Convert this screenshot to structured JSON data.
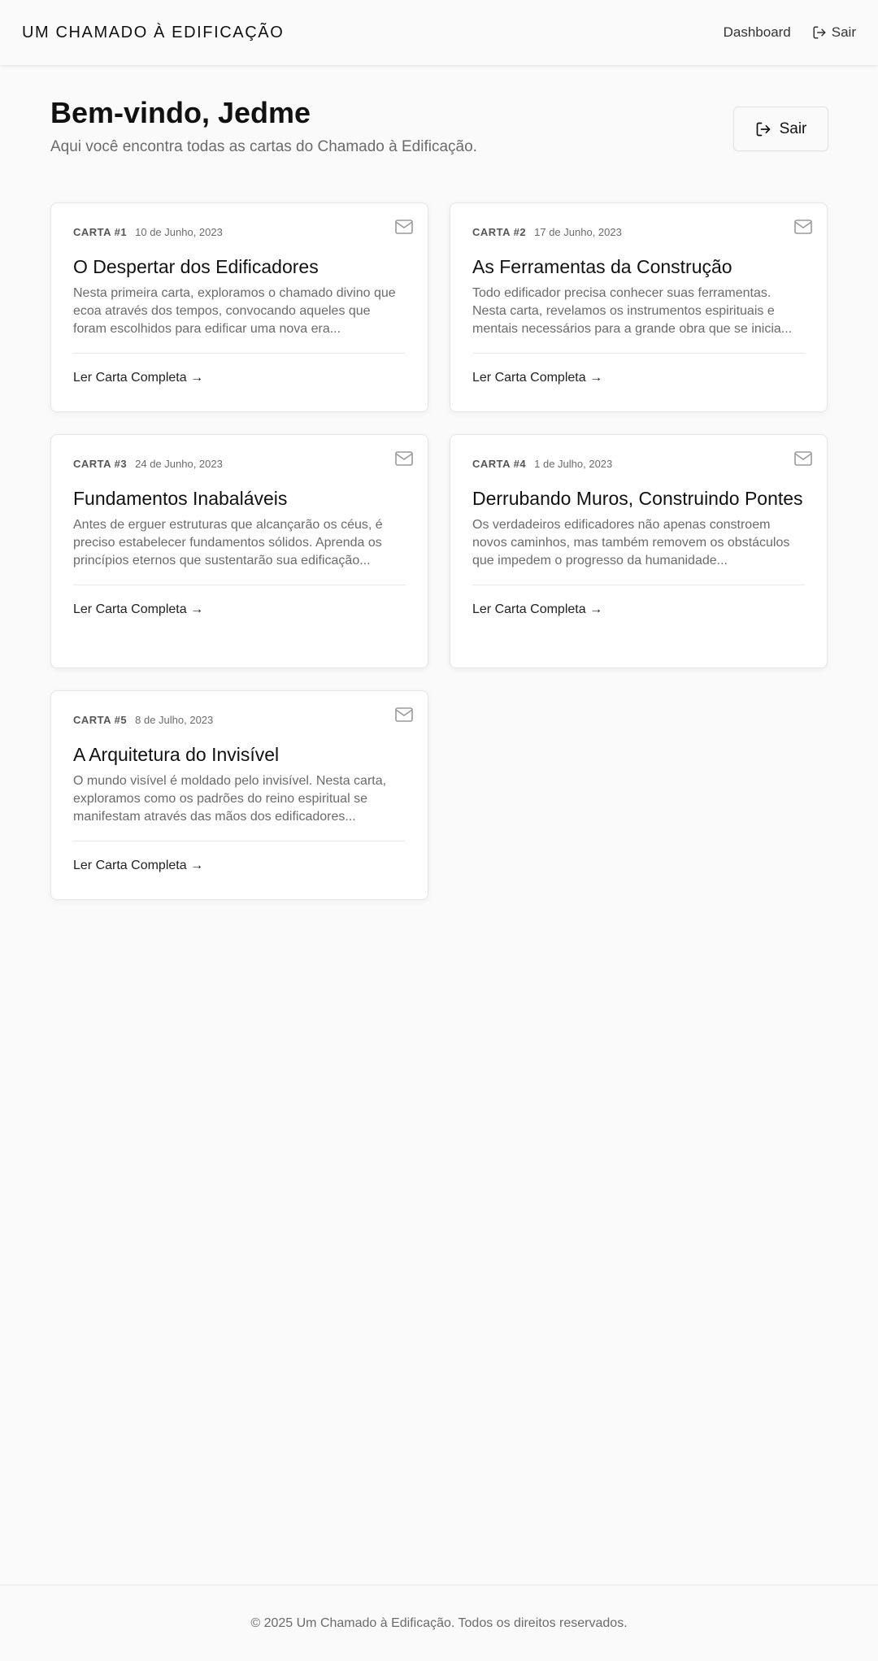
{
  "header": {
    "brand": "UM CHAMADO À EDIFICAÇÃO",
    "nav_dashboard": "Dashboard",
    "nav_logout": "Sair"
  },
  "welcome": {
    "title": "Bem-vindo, Jedme",
    "subtitle": "Aqui você encontra todas as cartas do Chamado à Edificação.",
    "logout_label": "Sair"
  },
  "cards": [
    {
      "number": "CARTA #1",
      "date": "10 de Junho, 2023",
      "title": "O Despertar dos Edificadores",
      "excerpt": "Nesta primeira carta, exploramos o chamado divino que ecoa através dos tempos, convocando aqueles que foram escolhidos para edificar uma nova era...",
      "link": "Ler Carta Completa →"
    },
    {
      "number": "CARTA #2",
      "date": "17 de Junho, 2023",
      "title": "As Ferramentas da Construção",
      "excerpt": "Todo edificador precisa conhecer suas ferramentas. Nesta carta, revelamos os instrumentos espirituais e mentais necessários para a grande obra que se inicia...",
      "link": "Ler Carta Completa →"
    },
    {
      "number": "CARTA #3",
      "date": "24 de Junho, 2023",
      "title": "Fundamentos Inabaláveis",
      "excerpt": "Antes de erguer estruturas que alcançarão os céus, é preciso estabelecer fundamentos sólidos. Aprenda os princípios eternos que sustentarão sua edificação...",
      "link": "Ler Carta Completa →"
    },
    {
      "number": "CARTA #4",
      "date": "1 de Julho, 2023",
      "title": "Derrubando Muros, Construindo Pontes",
      "excerpt": "Os verdadeiros edificadores não apenas constroem novos caminhos, mas também removem os obstáculos que impedem o progresso da humanidade...",
      "link": "Ler Carta Completa →"
    },
    {
      "number": "CARTA #5",
      "date": "8 de Julho, 2023",
      "title": "A Arquitetura do Invisível",
      "excerpt": "O mundo visível é moldado pelo invisível. Nesta carta, exploramos como os padrões do reino espiritual se manifestam através das mãos dos edificadores...",
      "link": "Ler Carta Completa →"
    }
  ],
  "footer": {
    "text": "© 2025 Um Chamado à Edificação. Todos os direitos reservados."
  }
}
